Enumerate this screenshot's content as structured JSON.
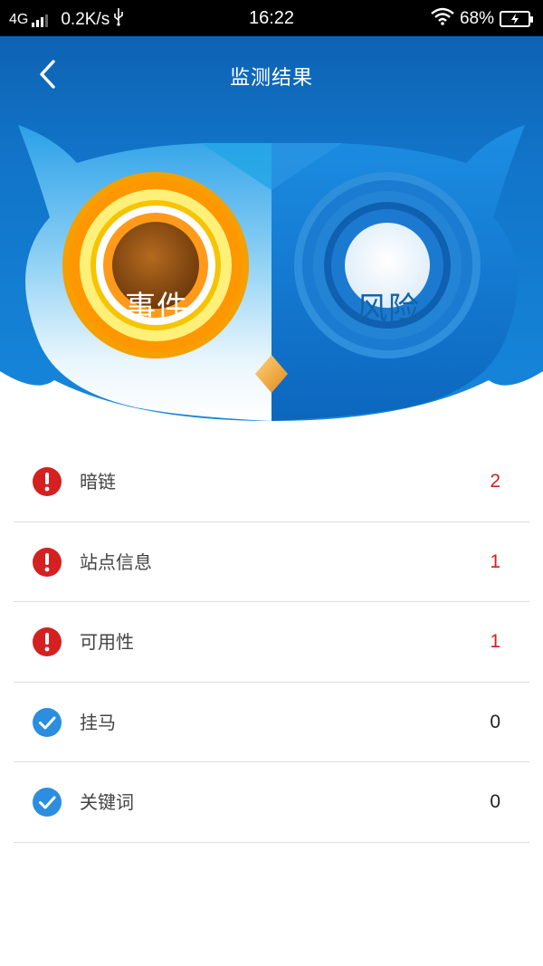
{
  "status_bar": {
    "network": "4G",
    "speed": "0.2K/s",
    "usb_icon": "usb-icon",
    "time": "16:22",
    "battery_percent": "68%"
  },
  "header": {
    "title": "监测结果",
    "back_icon": "chevron-left-icon",
    "event_label": "事件",
    "risk_label": "风险"
  },
  "colors": {
    "header_blue": "#1174c8",
    "alert_red": "#d42020",
    "ok_blue": "#2b8ede"
  },
  "results": [
    {
      "label": "暗链",
      "count": "2",
      "status": "alert",
      "icon": "alert-icon"
    },
    {
      "label": "站点信息",
      "count": "1",
      "status": "alert",
      "icon": "alert-icon"
    },
    {
      "label": "可用性",
      "count": "1",
      "status": "alert",
      "icon": "alert-icon"
    },
    {
      "label": "挂马",
      "count": "0",
      "status": "ok",
      "icon": "check-icon"
    },
    {
      "label": "关键词",
      "count": "0",
      "status": "ok",
      "icon": "check-icon"
    }
  ]
}
